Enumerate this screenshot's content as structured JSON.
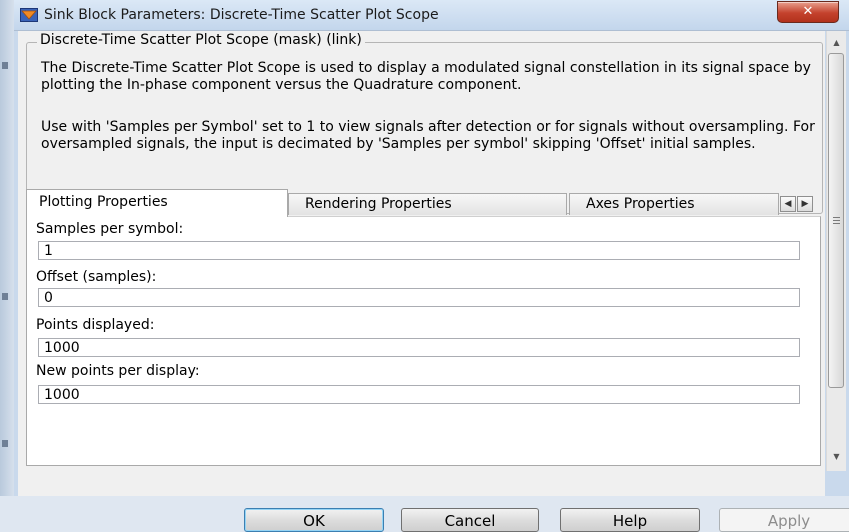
{
  "window": {
    "title": "Sink Block Parameters: Discrete-Time Scatter Plot Scope",
    "close_glyph": "✕"
  },
  "description": {
    "group_title": "Discrete-Time Scatter Plot Scope (mask) (link)",
    "paragraph1": "The Discrete-Time Scatter Plot Scope is used to display a modulated signal constellation in its signal space by plotting the In-phase component versus the Quadrature component.",
    "paragraph2": "Use with 'Samples per Symbol' set to 1 to view signals after detection or for signals without oversampling.  For oversampled signals, the input is decimated by 'Samples per symbol' skipping 'Offset' initial samples."
  },
  "tabs": [
    {
      "label": "Plotting Properties",
      "active": true
    },
    {
      "label": "Rendering Properties",
      "active": false
    },
    {
      "label": "Axes Properties",
      "active": false
    }
  ],
  "tab_scroll": {
    "left_glyph": "◀",
    "right_glyph": "▶"
  },
  "fields": [
    {
      "label": "Samples per symbol:",
      "value": "1"
    },
    {
      "label": "Offset (samples):",
      "value": "0"
    },
    {
      "label": "Points displayed:",
      "value": "1000"
    },
    {
      "label": "New points per display:",
      "value": "1000"
    }
  ],
  "scrollbar": {
    "up_glyph": "▲",
    "down_glyph": "▼"
  },
  "buttons": {
    "ok": "OK",
    "cancel": "Cancel",
    "help": "Help",
    "apply": "Apply"
  },
  "colors": {
    "close": "#c4422d",
    "default_button_border": "#3c7fb1",
    "window_frame": "#c9d9ec"
  }
}
